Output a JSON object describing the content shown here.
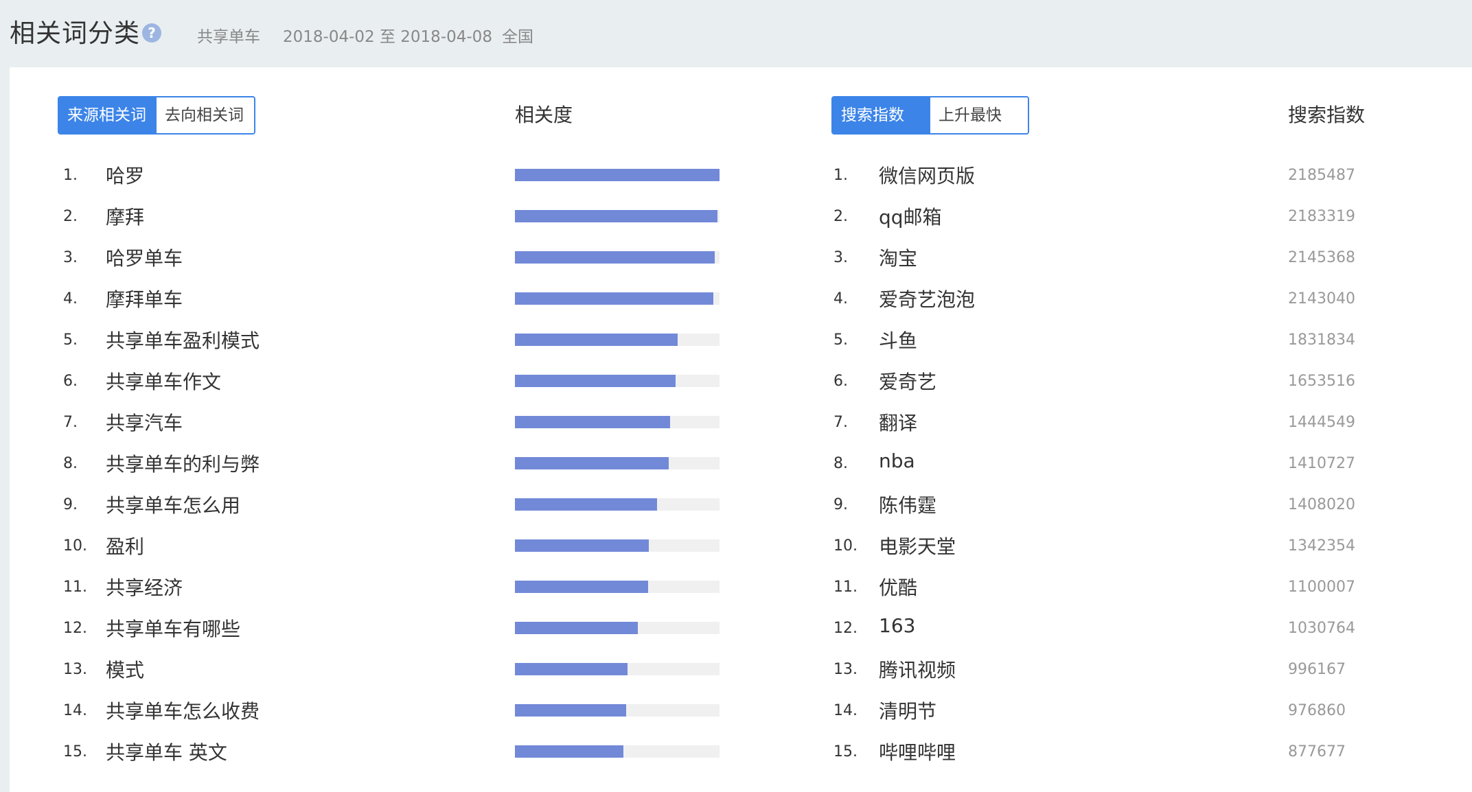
{
  "header": {
    "title": "相关词分类",
    "help_icon": "question-circle-icon",
    "keyword": "共享单车",
    "date_range": "2018-04-02 至 2018-04-08",
    "region": "全国"
  },
  "left_panel": {
    "tabs": [
      {
        "label": "来源相关词",
        "active": true
      },
      {
        "label": "去向相关词",
        "active": false
      }
    ],
    "metric_header": "相关度",
    "items": [
      {
        "rank": "1.",
        "keyword": "哈罗",
        "relevance": 1.0
      },
      {
        "rank": "2.",
        "keyword": "摩拜",
        "relevance": 0.99
      },
      {
        "rank": "3.",
        "keyword": "哈罗单车",
        "relevance": 0.975
      },
      {
        "rank": "4.",
        "keyword": "摩拜单车",
        "relevance": 0.97
      },
      {
        "rank": "5.",
        "keyword": "共享单车盈利模式",
        "relevance": 0.795
      },
      {
        "rank": "6.",
        "keyword": "共享单车作文",
        "relevance": 0.785
      },
      {
        "rank": "7.",
        "keyword": "共享汽车",
        "relevance": 0.76
      },
      {
        "rank": "8.",
        "keyword": "共享单车的利与弊",
        "relevance": 0.75
      },
      {
        "rank": "9.",
        "keyword": "共享单车怎么用",
        "relevance": 0.695
      },
      {
        "rank": "10.",
        "keyword": "盈利",
        "relevance": 0.655
      },
      {
        "rank": "11.",
        "keyword": "共享经济",
        "relevance": 0.65
      },
      {
        "rank": "12.",
        "keyword": "共享单车有哪些",
        "relevance": 0.6
      },
      {
        "rank": "13.",
        "keyword": "模式",
        "relevance": 0.55
      },
      {
        "rank": "14.",
        "keyword": "共享单车怎么收费",
        "relevance": 0.545
      },
      {
        "rank": "15.",
        "keyword": "共享单车 英文",
        "relevance": 0.53
      }
    ]
  },
  "right_panel": {
    "tabs": [
      {
        "label": "搜索指数",
        "active": true
      },
      {
        "label": "上升最快",
        "active": false
      }
    ],
    "metric_header": "搜索指数",
    "items": [
      {
        "rank": "1.",
        "keyword": "微信网页版",
        "index": "2185487"
      },
      {
        "rank": "2.",
        "keyword": "qq邮箱",
        "index": "2183319"
      },
      {
        "rank": "3.",
        "keyword": "淘宝",
        "index": "2145368"
      },
      {
        "rank": "4.",
        "keyword": "爱奇艺泡泡",
        "index": "2143040"
      },
      {
        "rank": "5.",
        "keyword": "斗鱼",
        "index": "1831834"
      },
      {
        "rank": "6.",
        "keyword": "爱奇艺",
        "index": "1653516"
      },
      {
        "rank": "7.",
        "keyword": "翻译",
        "index": "1444549"
      },
      {
        "rank": "8.",
        "keyword": "nba",
        "index": "1410727"
      },
      {
        "rank": "9.",
        "keyword": "陈伟霆",
        "index": "1408020"
      },
      {
        "rank": "10.",
        "keyword": "电影天堂",
        "index": "1342354"
      },
      {
        "rank": "11.",
        "keyword": "优酷",
        "index": "1100007"
      },
      {
        "rank": "12.",
        "keyword": "163",
        "index": "1030764"
      },
      {
        "rank": "13.",
        "keyword": "腾讯视频",
        "index": "996167"
      },
      {
        "rank": "14.",
        "keyword": "清明节",
        "index": "976860"
      },
      {
        "rank": "15.",
        "keyword": "哔哩哔哩",
        "index": "877677"
      }
    ]
  },
  "colors": {
    "accent": "#3c84e8",
    "bar_fill": "#7289d8",
    "bar_track": "#f0f0f0",
    "background": "#e9eef1"
  }
}
